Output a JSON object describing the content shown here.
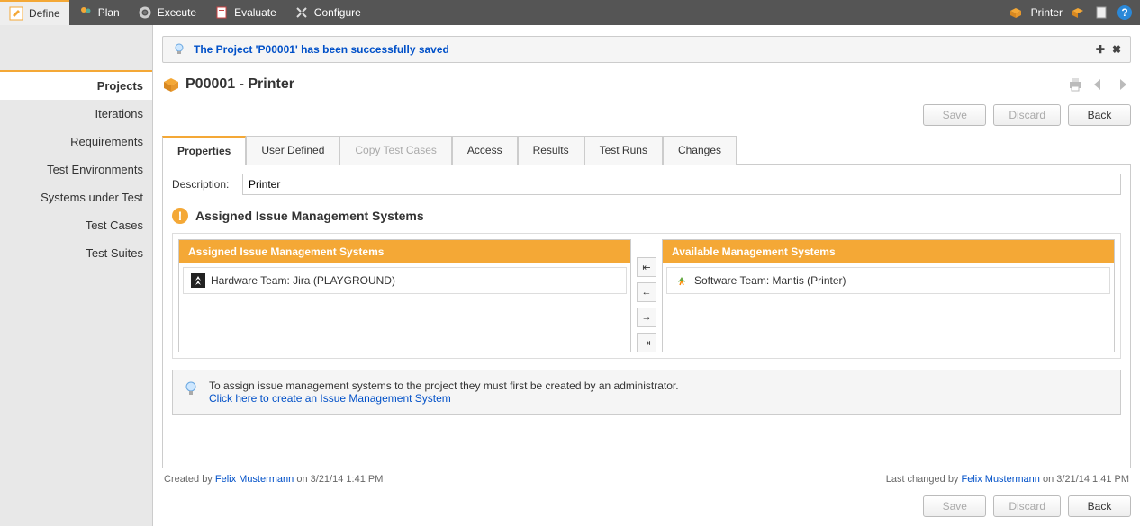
{
  "topbar": {
    "tabs": [
      {
        "label": "Define"
      },
      {
        "label": "Plan"
      },
      {
        "label": "Execute"
      },
      {
        "label": "Evaluate"
      },
      {
        "label": "Configure"
      }
    ],
    "breadcrumb_label": "Printer"
  },
  "sidebar": {
    "items": [
      {
        "label": "Projects"
      },
      {
        "label": "Iterations"
      },
      {
        "label": "Requirements"
      },
      {
        "label": "Test Environments"
      },
      {
        "label": "Systems under Test"
      },
      {
        "label": "Test Cases"
      },
      {
        "label": "Test Suites"
      }
    ]
  },
  "notification": {
    "message": "The Project 'P00001' has been successfully saved"
  },
  "header": {
    "title": "P00001 - Printer"
  },
  "buttons": {
    "save": "Save",
    "discard": "Discard",
    "back": "Back"
  },
  "tabs": [
    {
      "label": "Properties"
    },
    {
      "label": "User Defined"
    },
    {
      "label": "Copy Test Cases"
    },
    {
      "label": "Access"
    },
    {
      "label": "Results"
    },
    {
      "label": "Test Runs"
    },
    {
      "label": "Changes"
    }
  ],
  "form": {
    "description_label": "Description:",
    "description_value": "Printer"
  },
  "section": {
    "title": "Assigned Issue Management Systems",
    "assigned_header": "Assigned Issue Management Systems",
    "available_header": "Available Management Systems",
    "assigned_items": [
      {
        "text": "Hardware Team: Jira (PLAYGROUND)"
      }
    ],
    "available_items": [
      {
        "text": "Software Team: Mantis (Printer)"
      }
    ]
  },
  "infobox": {
    "line1": "To assign issue management systems to the project they must first be created by an administrator.",
    "link": "Click here to create an Issue Management System"
  },
  "footer": {
    "created_prefix": "Created by ",
    "created_user": "Felix Mustermann",
    "created_suffix": " on 3/21/14 1:41 PM",
    "changed_prefix": "Last changed by ",
    "changed_user": "Felix Mustermann",
    "changed_suffix": " on 3/21/14 1:41 PM"
  }
}
